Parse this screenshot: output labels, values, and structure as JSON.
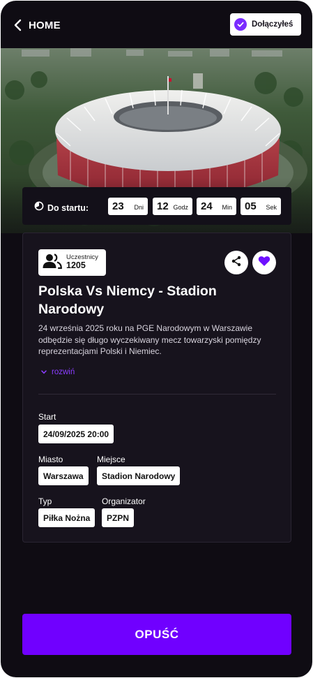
{
  "header": {
    "back_label": "HOME",
    "joined_label": "Dołączyłeś"
  },
  "hero": {
    "image_name": "stadium-aerial-photo"
  },
  "countdown": {
    "label": "Do startu:",
    "units": [
      {
        "value": "23",
        "unit": "Dni"
      },
      {
        "value": "12",
        "unit": "Godz"
      },
      {
        "value": "24",
        "unit": "Min"
      },
      {
        "value": "05",
        "unit": "Sek"
      }
    ]
  },
  "event": {
    "participants_label": "Uczestnicy",
    "participants_count": "1205",
    "title": "Polska Vs Niemcy - Stadion Narodowy",
    "description": "24 września 2025 roku na PGE Narodowym w Warszawie odbędzie się długo wyczekiwany mecz towarzyski pomiędzy reprezentacjami Polski i Niemiec.",
    "expand_label": "rozwiń",
    "fields": {
      "start_label": "Start",
      "start_value": "24/09/2025 20:00",
      "city_label": "Miasto",
      "city_value": "Warszawa",
      "place_label": "Miejsce",
      "place_value": "Stadion Narodowy",
      "type_label": "Typ",
      "type_value": "Piłka Nożna",
      "organizer_label": "Organizator",
      "organizer_value": "PZPN"
    }
  },
  "actions": {
    "leave_label": "OPUŚĆ"
  },
  "colors": {
    "background": "#0f0c13",
    "card": "#17131d",
    "accent": "#7000ff",
    "accent_link": "#8b3dff"
  },
  "icons": [
    "chevron-left-icon",
    "check-icon",
    "clock-icon",
    "users-icon",
    "share-icon",
    "heart-icon",
    "chevron-down-icon"
  ]
}
